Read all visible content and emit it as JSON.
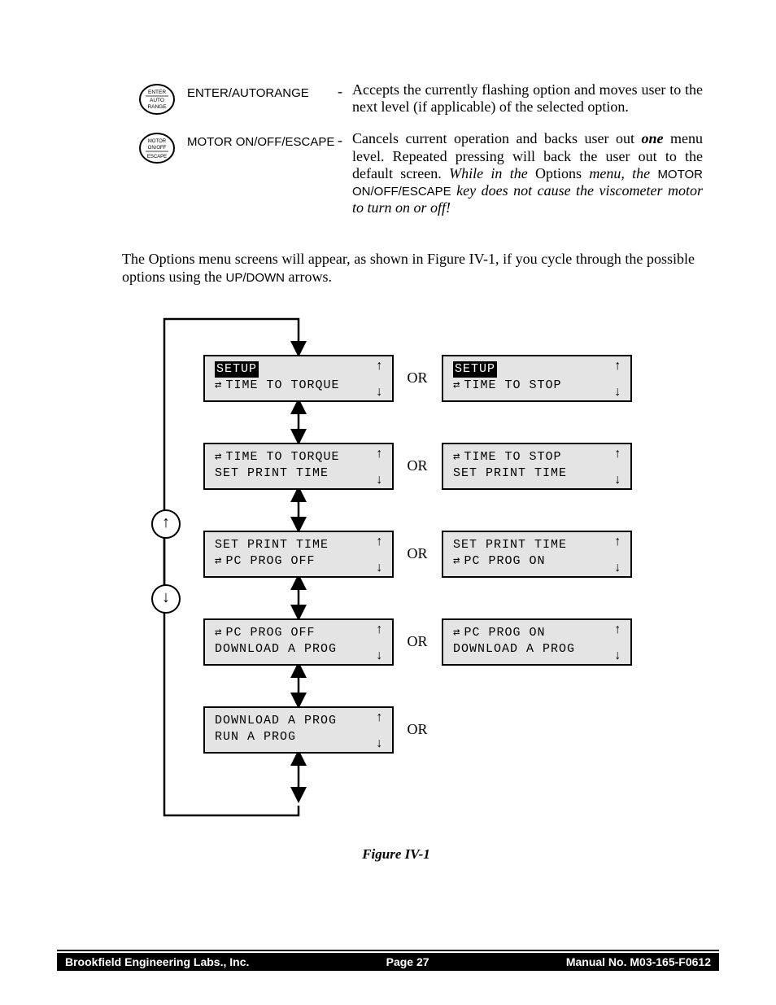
{
  "keys": {
    "enter": {
      "icon_top": "ENTER",
      "icon_mid": "AUTO",
      "icon_bot": "RANGE",
      "name": "ENTER/AUTORANGE",
      "dash": "-",
      "desc_plain": "Accepts the currently flashing option and moves user to the next level (if applicable) of the selected option."
    },
    "motor": {
      "icon_top": "MOTOR",
      "icon_mid": "ON/OFF",
      "icon_bot": "ESCAPE",
      "name": "MOTOR ON/OFF/ESCAPE",
      "dash": "-",
      "desc_p1": "Cancels current operation and backs user out ",
      "desc_one": "one",
      "desc_p2": " menu level.   Repeated pressing will back the user out to the default screen.  ",
      "desc_i1": "While  in  the ",
      "desc_options": "Options",
      "desc_i2": " menu, the ",
      "desc_sc": "MOTOR ON/OFF/ESCAPE",
      "desc_i3": " key does not  cause the  viscometer motor to turn on or off!"
    }
  },
  "paragraph": {
    "p1": "The Options menu screens will appear, as shown in Figure IV-1, if you cycle through the possible options using the ",
    "sc": "UP/DOWN",
    "p2": " arrows."
  },
  "figure": {
    "caption": "Figure IV-1",
    "or": "OR",
    "swap_glyph": "⇄",
    "up": "↑",
    "down": "↓",
    "circ_up": "↑",
    "circ_down": "↓",
    "boxes": {
      "L1_top_inv": "SETUP",
      "L1_bot": "TIME TO TORQUE",
      "R1_top_inv": "SETUP",
      "R1_bot": "TIME TO STOP",
      "L2_top": "TIME TO TORQUE",
      "L2_bot": "SET PRINT TIME",
      "R2_top": "TIME TO STOP",
      "R2_bot": "SET PRINT TIME",
      "L3_top": "SET PRINT TIME",
      "L3_bot": "PC PROG OFF",
      "R3_top": "SET PRINT TIME",
      "R3_bot": "PC PROG ON",
      "L4_top": "PC PROG OFF",
      "L4_bot": "DOWNLOAD A PROG",
      "R4_top": "PC PROG ON",
      "R4_bot": "DOWNLOAD A PROG",
      "L5_top": "DOWNLOAD A PROG",
      "L5_bot": "RUN A PROG"
    }
  },
  "footer": {
    "left": "Brookfield Engineering Labs., Inc.",
    "center": "Page  27",
    "right": "Manual No. M03-165-F0612"
  }
}
